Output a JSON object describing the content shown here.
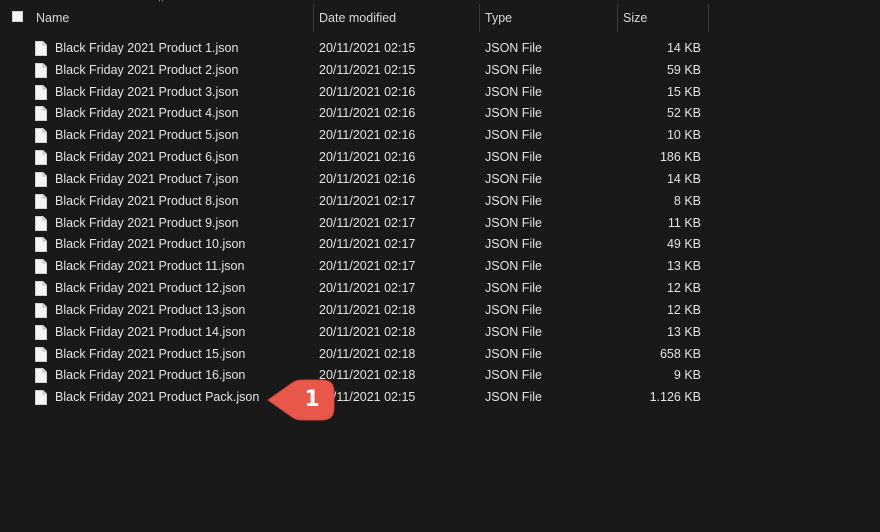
{
  "header": {
    "name_label": "Name",
    "date_label": "Date modified",
    "type_label": "Type",
    "size_label": "Size",
    "sort_indicator": "^"
  },
  "files": [
    {
      "name": "Black Friday 2021 Product 1.json",
      "date": "20/11/2021 02:15",
      "type": "JSON File",
      "size": "14 KB"
    },
    {
      "name": "Black Friday 2021 Product 2.json",
      "date": "20/11/2021 02:15",
      "type": "JSON File",
      "size": "59 KB"
    },
    {
      "name": "Black Friday 2021 Product 3.json",
      "date": "20/11/2021 02:16",
      "type": "JSON File",
      "size": "15 KB"
    },
    {
      "name": "Black Friday 2021 Product 4.json",
      "date": "20/11/2021 02:16",
      "type": "JSON File",
      "size": "52 KB"
    },
    {
      "name": "Black Friday 2021 Product 5.json",
      "date": "20/11/2021 02:16",
      "type": "JSON File",
      "size": "10 KB"
    },
    {
      "name": "Black Friday 2021 Product 6.json",
      "date": "20/11/2021 02:16",
      "type": "JSON File",
      "size": "186 KB"
    },
    {
      "name": "Black Friday 2021 Product 7.json",
      "date": "20/11/2021 02:16",
      "type": "JSON File",
      "size": "14 KB"
    },
    {
      "name": "Black Friday 2021 Product 8.json",
      "date": "20/11/2021 02:17",
      "type": "JSON File",
      "size": "8 KB"
    },
    {
      "name": "Black Friday 2021 Product 9.json",
      "date": "20/11/2021 02:17",
      "type": "JSON File",
      "size": "11 KB"
    },
    {
      "name": "Black Friday 2021 Product 10.json",
      "date": "20/11/2021 02:17",
      "type": "JSON File",
      "size": "49 KB"
    },
    {
      "name": "Black Friday 2021 Product 11.json",
      "date": "20/11/2021 02:17",
      "type": "JSON File",
      "size": "13 KB"
    },
    {
      "name": "Black Friday 2021 Product 12.json",
      "date": "20/11/2021 02:17",
      "type": "JSON File",
      "size": "12 KB"
    },
    {
      "name": "Black Friday 2021 Product 13.json",
      "date": "20/11/2021 02:18",
      "type": "JSON File",
      "size": "12 KB"
    },
    {
      "name": "Black Friday 2021 Product 14.json",
      "date": "20/11/2021 02:18",
      "type": "JSON File",
      "size": "13 KB"
    },
    {
      "name": "Black Friday 2021 Product 15.json",
      "date": "20/11/2021 02:18",
      "type": "JSON File",
      "size": "658 KB"
    },
    {
      "name": "Black Friday 2021 Product 16.json",
      "date": "20/11/2021 02:18",
      "type": "JSON File",
      "size": "9 KB"
    },
    {
      "name": "Black Friday 2021 Product Pack.json",
      "date": "20/11/2021 02:15",
      "type": "JSON File",
      "size": "1.126 KB"
    }
  ],
  "callout": {
    "number": "1",
    "color": "#e8574a"
  },
  "icons": {
    "file": "file-icon",
    "checkbox": "select-all-checkbox"
  },
  "colors": {
    "background": "#191919",
    "text": "#e2e2e2",
    "divider": "#3b3b3b"
  }
}
